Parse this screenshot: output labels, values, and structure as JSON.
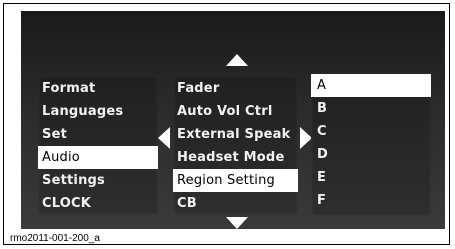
{
  "column1": {
    "items": [
      {
        "label": "Format"
      },
      {
        "label": "Languages"
      },
      {
        "label": "Set"
      },
      {
        "label": "Audio",
        "selected": true
      },
      {
        "label": "Settings"
      },
      {
        "label": "CLOCK"
      }
    ]
  },
  "column2": {
    "items": [
      {
        "label": "Fader"
      },
      {
        "label": "Auto Vol Ctrl"
      },
      {
        "label": "External Speak"
      },
      {
        "label": "Headset Mode"
      },
      {
        "label": "Region Setting",
        "selected": true
      },
      {
        "label": "CB"
      }
    ]
  },
  "column3": {
    "items": [
      {
        "label": "A",
        "selected": true
      },
      {
        "label": "B"
      },
      {
        "label": "C"
      },
      {
        "label": "D"
      },
      {
        "label": "E"
      },
      {
        "label": "F"
      }
    ]
  },
  "nav_icons": [
    "arrow-up-icon",
    "arrow-down-icon",
    "arrow-left-icon",
    "arrow-right-icon"
  ],
  "caption": "rmo2011-001-200_a",
  "colors": {
    "screen_background": "#2b2b2b",
    "text": "#f2f2f2",
    "selection_background": "#ffffff",
    "selection_text": "#000000"
  }
}
